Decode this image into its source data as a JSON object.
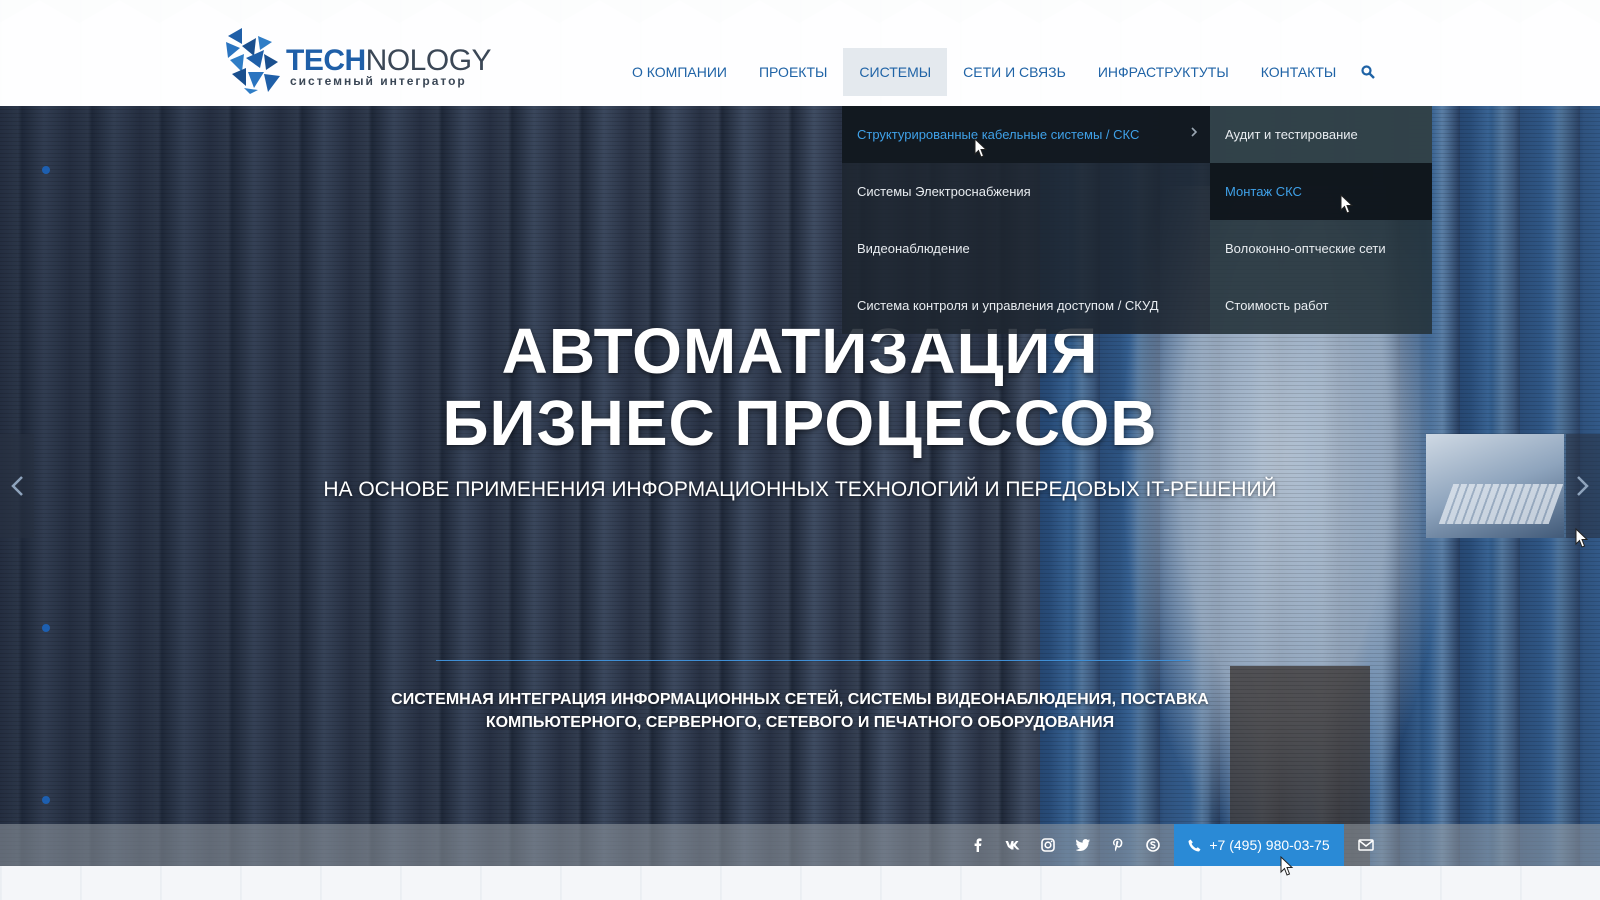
{
  "brand": {
    "name_bold": "TECH",
    "name_light": "NOLOGY",
    "tagline": "системный интегратор",
    "colors": {
      "primary": "#1f5fa8",
      "accent": "#2a8ad6",
      "link_hover": "#3fa1e8"
    }
  },
  "nav": {
    "items": [
      {
        "label": "О КОМПАНИИ"
      },
      {
        "label": "ПРОЕКТЫ"
      },
      {
        "label": "СИСТЕМЫ"
      },
      {
        "label": "СЕТИ И СВЯЗЬ"
      },
      {
        "label": "ИНФРАСТРУКТУТЫ"
      },
      {
        "label": "КОНТАКТЫ"
      }
    ],
    "active": "СИСТЕМЫ",
    "search_icon": "search-icon"
  },
  "dropdown": {
    "items": [
      {
        "label": "Структурированные кабельные системы / СКС"
      },
      {
        "label": "Системы Электроснабжения"
      },
      {
        "label": "Видеонаблюдение"
      },
      {
        "label": "Система контроля и управления доступом / СКУД"
      }
    ],
    "submenu": [
      {
        "label": "Аудит и тестирование"
      },
      {
        "label": "Монтаж СКС"
      },
      {
        "label": "Волоконно-оптческие сети"
      },
      {
        "label": "Стоимость работ"
      }
    ]
  },
  "hero": {
    "title_line1": "АВТОМАТИЗАЦИЯ",
    "title_line2": "БИЗНЕС ПРОЦЕССОВ",
    "subtitle": "НА ОСНОВЕ ПРИМЕНЕНИЯ ИНФОРМАЦИОННЫХ ТЕХНОЛОГИЙ И ПЕРЕДОВЫХ IT-РЕШЕНИЙ",
    "desc_line1": "СИСТЕМНАЯ ИНТЕГРАЦИЯ ИНФОРМАЦИОННЫХ СЕТЕЙ, СИСТЕМЫ ВИДЕОНАБЛЮДЕНИЯ, ПОСТАВКА",
    "desc_line2": "КОМПЬЮТЕРНОГО, СЕРВЕРНОГО, СЕТЕВОГО И ПЕЧАТНОГО ОБОРУДОВАНИЯ"
  },
  "contact_bar": {
    "social": [
      "facebook-icon",
      "vk-icon",
      "instagram-icon",
      "twitter-icon",
      "pinterest-icon",
      "skype-icon"
    ],
    "phone": "+7 (495) 980-03-75",
    "mail_icon": "mail-icon"
  }
}
